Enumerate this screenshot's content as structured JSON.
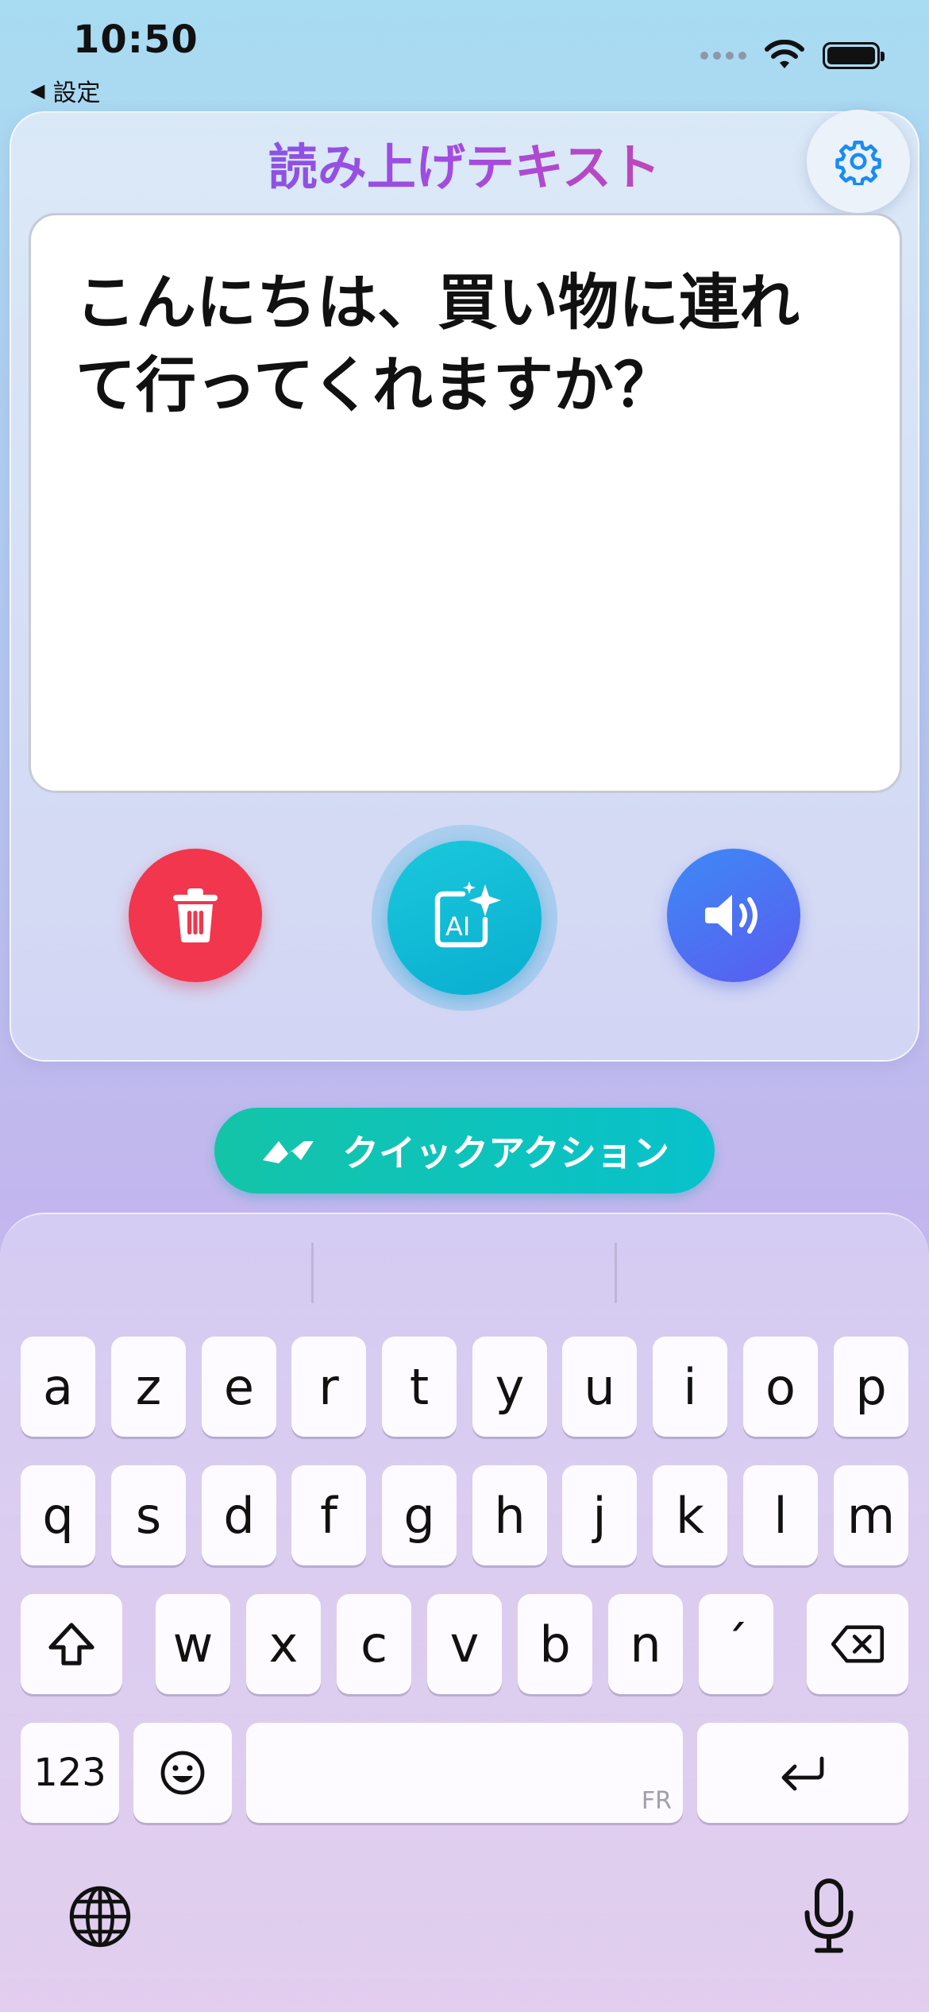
{
  "status": {
    "time": "10:50",
    "back_label": "設定"
  },
  "header": {
    "title": "読み上げテキスト"
  },
  "textbox": {
    "text": "こんにちは、買い物に連れて行ってくれますか？"
  },
  "quick_action": {
    "label": "クイックアクション"
  },
  "keyboard": {
    "row1": [
      "a",
      "z",
      "e",
      "r",
      "t",
      "y",
      "u",
      "i",
      "o",
      "p"
    ],
    "row2": [
      "q",
      "s",
      "d",
      "f",
      "g",
      "h",
      "j",
      "k",
      "l",
      "m"
    ],
    "row3": [
      "w",
      "x",
      "c",
      "v",
      "b",
      "n",
      "´"
    ],
    "numbers_label": "123",
    "space_lang": "FR"
  },
  "colors": {
    "delete": "#f2364e",
    "ai": "#1ac8dc",
    "speak": "#4a74f2",
    "quick": "#10c3ba"
  },
  "icons": [
    "gear-icon",
    "trash-icon",
    "ai-sparkle-icon",
    "speaker-icon",
    "quick-action-icon",
    "shift-icon",
    "backspace-icon",
    "emoji-icon",
    "return-icon",
    "globe-icon",
    "mic-icon"
  ]
}
